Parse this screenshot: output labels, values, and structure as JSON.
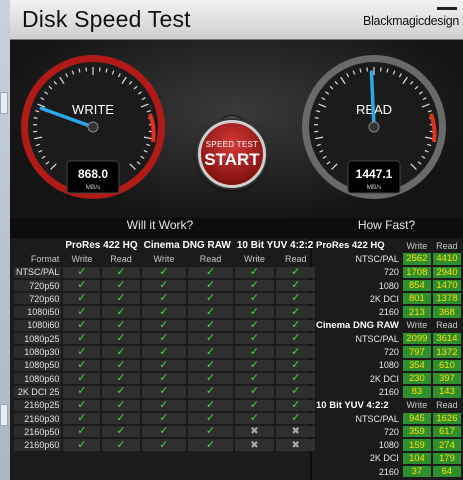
{
  "window": {
    "title": "Disk Speed Test",
    "brand": "Blackmagicdesign"
  },
  "gauges": {
    "write": {
      "label": "WRITE",
      "value": "868.0",
      "unit": "MB/s"
    },
    "read": {
      "label": "READ",
      "value": "1447.1",
      "unit": "MB/s"
    }
  },
  "start_button": {
    "small": "SPEED TEST",
    "big": "START"
  },
  "sections": {
    "left": "Will it Work?",
    "right": "How Fast?"
  },
  "will_it_work": {
    "format_header": "Format",
    "groups": [
      "ProRes 422 HQ",
      "Cinema DNG RAW",
      "10 Bit YUV 4:2:2"
    ],
    "sub": [
      "Write",
      "Read"
    ],
    "rows": [
      {
        "format": "NTSC/PAL",
        "cells": [
          "y",
          "y",
          "y",
          "y",
          "y",
          "y"
        ]
      },
      {
        "format": "720p50",
        "cells": [
          "y",
          "y",
          "y",
          "y",
          "y",
          "y"
        ]
      },
      {
        "format": "720p60",
        "cells": [
          "y",
          "y",
          "y",
          "y",
          "y",
          "y"
        ]
      },
      {
        "format": "1080i50",
        "cells": [
          "y",
          "y",
          "y",
          "y",
          "y",
          "y"
        ]
      },
      {
        "format": "1080i60",
        "cells": [
          "y",
          "y",
          "y",
          "y",
          "y",
          "y"
        ]
      },
      {
        "format": "1080p25",
        "cells": [
          "y",
          "y",
          "y",
          "y",
          "y",
          "y"
        ]
      },
      {
        "format": "1080p30",
        "cells": [
          "y",
          "y",
          "y",
          "y",
          "y",
          "y"
        ]
      },
      {
        "format": "1080p50",
        "cells": [
          "y",
          "y",
          "y",
          "y",
          "y",
          "y"
        ]
      },
      {
        "format": "1080p60",
        "cells": [
          "y",
          "y",
          "y",
          "y",
          "y",
          "y"
        ]
      },
      {
        "format": "2K DCI 25",
        "cells": [
          "y",
          "y",
          "y",
          "y",
          "y",
          "y"
        ]
      },
      {
        "format": "2160p25",
        "cells": [
          "y",
          "y",
          "y",
          "y",
          "y",
          "y"
        ]
      },
      {
        "format": "2160p30",
        "cells": [
          "y",
          "y",
          "y",
          "y",
          "y",
          "y"
        ]
      },
      {
        "format": "2160p50",
        "cells": [
          "y",
          "y",
          "y",
          "y",
          "x",
          "x"
        ]
      },
      {
        "format": "2160p60",
        "cells": [
          "y",
          "y",
          "y",
          "y",
          "x",
          "x"
        ]
      }
    ]
  },
  "how_fast": {
    "sub": [
      "Write",
      "Read"
    ],
    "groups": [
      {
        "name": "ProRes 422 HQ",
        "rows": [
          {
            "res": "NTSC/PAL",
            "write": "2562",
            "read": "4410"
          },
          {
            "res": "720",
            "write": "1708",
            "read": "2940"
          },
          {
            "res": "1080",
            "write": "854",
            "read": "1470"
          },
          {
            "res": "2K DCI",
            "write": "801",
            "read": "1378"
          },
          {
            "res": "2160",
            "write": "213",
            "read": "368"
          }
        ]
      },
      {
        "name": "Cinema DNG RAW",
        "rows": [
          {
            "res": "NTSC/PAL",
            "write": "2099",
            "read": "3614"
          },
          {
            "res": "720",
            "write": "797",
            "read": "1372"
          },
          {
            "res": "1080",
            "write": "354",
            "read": "610"
          },
          {
            "res": "2K DCI",
            "write": "230",
            "read": "397"
          },
          {
            "res": "2160",
            "write": "83",
            "read": "143"
          }
        ]
      },
      {
        "name": "10 Bit YUV 4:2:2",
        "rows": [
          {
            "res": "NTSC/PAL",
            "write": "945",
            "read": "1626"
          },
          {
            "res": "720",
            "write": "359",
            "read": "617"
          },
          {
            "res": "1080",
            "write": "159",
            "read": "274"
          },
          {
            "res": "2K DCI",
            "write": "104",
            "read": "179"
          },
          {
            "res": "2160",
            "write": "37",
            "read": "64"
          }
        ]
      }
    ]
  },
  "colors": {
    "check": "#47d647",
    "value_text": "#ffe000",
    "value_bg": "#2f8f2f",
    "needle": "#2aa8e8",
    "start": "#c0201c"
  },
  "gauge_scale": {
    "write_fraction": 0.24,
    "read_fraction": 0.49
  }
}
